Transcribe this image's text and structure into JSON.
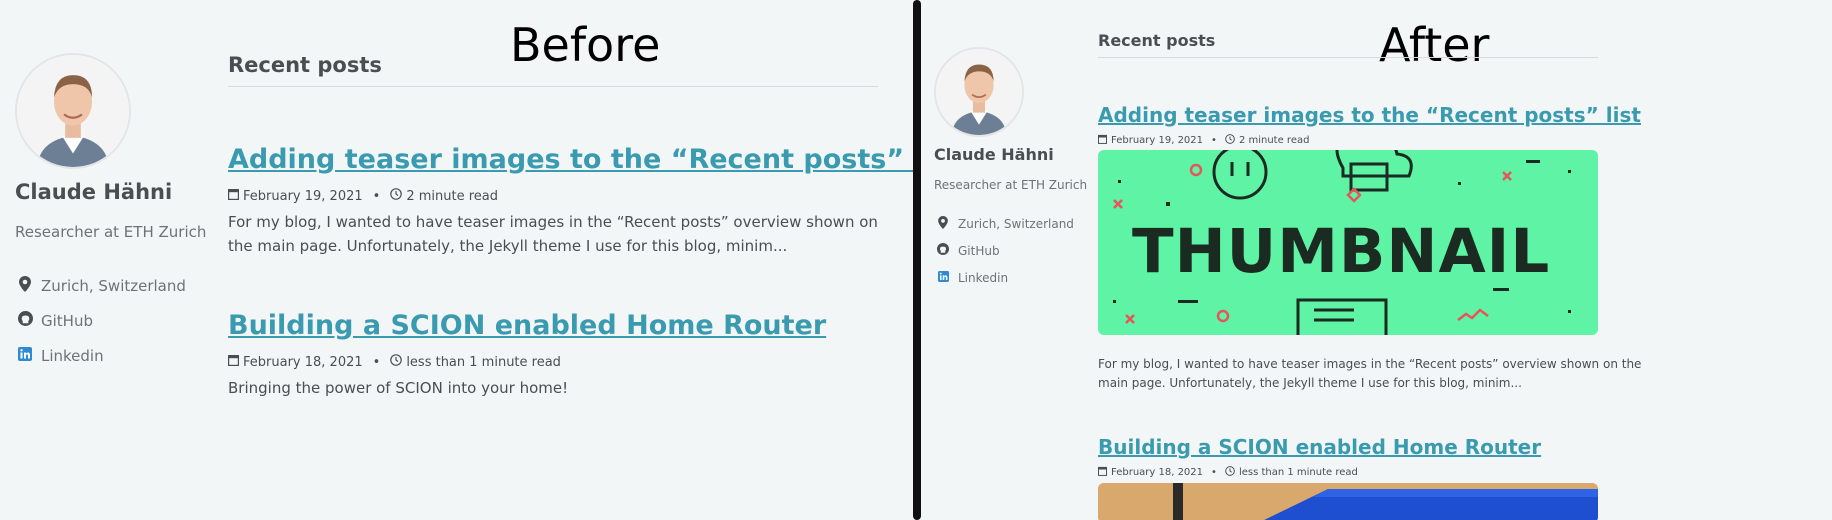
{
  "labels": {
    "before": "Before",
    "after": "After"
  },
  "author": {
    "name": "Claude Hähni",
    "bio": "Researcher at ETH Zurich",
    "links": [
      {
        "label": "Zurich, Switzerland",
        "icon": "map-marker-icon"
      },
      {
        "label": "GitHub",
        "icon": "github-icon"
      },
      {
        "label": "Linkedin",
        "icon": "linkedin-icon"
      }
    ]
  },
  "section_title": "Recent posts",
  "posts": [
    {
      "title": "Adding teaser images to the “Recent posts” list",
      "date": "February 19, 2021",
      "read_time": "2 minute read",
      "excerpt": "For my blog, I wanted to have teaser images in the “Recent posts” overview shown on the main page. Unfortunately, the Jekyll theme I use for this blog, minim...",
      "excerpt_lines": [
        "For my blog, I wanted to have teaser images in the “Recent posts” overview shown on the",
        "main page. Unfortunately, the Jekyll theme I use for this blog, minim..."
      ],
      "teaser_text": "THUMBNAIL"
    },
    {
      "title": "Building a SCION enabled Home Router",
      "date": "February 18, 2021",
      "read_time": "less than 1 minute read",
      "excerpt": "Bringing the power of SCION into your home!"
    }
  ],
  "colors": {
    "background": "#f3f6f7",
    "link": "#3a9aaf",
    "text": "#494e52",
    "muted": "#6e7277",
    "thumbnail_bg": "#5ef3a5",
    "linkedin": "#2f8bd1",
    "divider": "#111111"
  }
}
